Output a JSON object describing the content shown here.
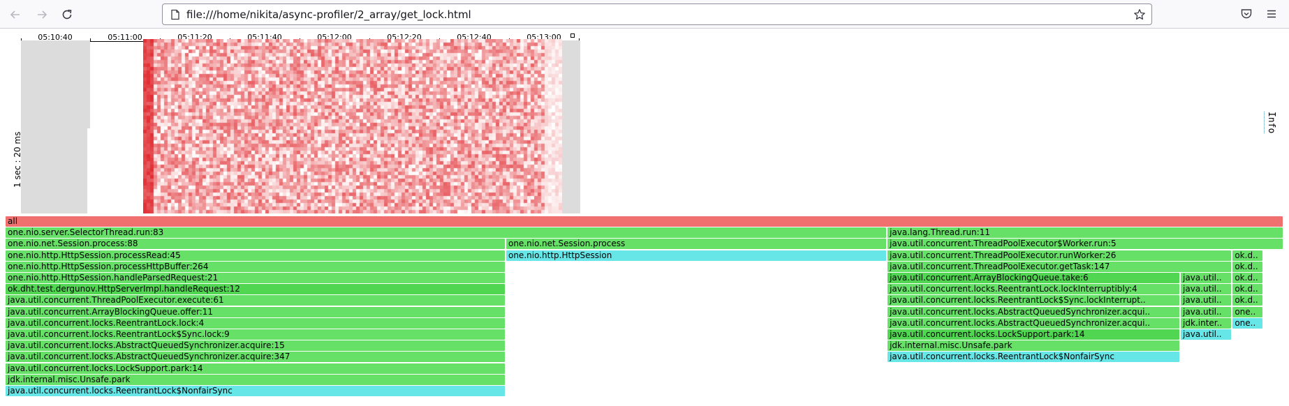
{
  "browser": {
    "url": "file:///home/nikita/async-profiler/2_array/get_lock.html"
  },
  "heatmap": {
    "time_ticks": [
      "05:10:40",
      "05:11:00",
      "05:11:20",
      "05:11:40",
      "05:12:00",
      "05:12:20",
      "05:12:40",
      "05:13:00"
    ],
    "y_label": "1 sec : 20 ms",
    "info_label": "Info",
    "colors": {
      "cold": "#ffffff",
      "hot": "#e0202a",
      "gap": "#dcdcdc"
    }
  },
  "flame": {
    "colors": {
      "root": "#f07070",
      "java": "#66e066",
      "java_dark": "#50d650",
      "inlined": "#66e6e6"
    },
    "frames": [
      {
        "label": "all",
        "row": 0,
        "start": 0.0,
        "width": 1.0,
        "kind": "root"
      },
      {
        "label": "one.nio.server.SelectorThread.run:83",
        "row": 1,
        "start": 0.0,
        "width": 0.6895,
        "kind": "java"
      },
      {
        "label": "one.nio.net.Session.process:88",
        "row": 2,
        "start": 0.0,
        "width": 0.3912,
        "kind": "java"
      },
      {
        "label": "one.nio.http.HttpSession.processRead:45",
        "row": 3,
        "start": 0.0,
        "width": 0.3912,
        "kind": "java"
      },
      {
        "label": "one.nio.http.HttpSession.processHttpBuffer:264",
        "row": 4,
        "start": 0.0,
        "width": 0.3912,
        "kind": "java"
      },
      {
        "label": "one.nio.http.HttpSession.handleParsedRequest:21",
        "row": 5,
        "start": 0.0,
        "width": 0.3912,
        "kind": "java"
      },
      {
        "label": "ok.dht.test.dergunov.HttpServerImpl.handleRequest:12",
        "row": 6,
        "start": 0.0,
        "width": 0.3912,
        "kind": "java_dark"
      },
      {
        "label": "java.util.concurrent.ThreadPoolExecutor.execute:61",
        "row": 7,
        "start": 0.0,
        "width": 0.3912,
        "kind": "java"
      },
      {
        "label": "java.util.concurrent.ArrayBlockingQueue.offer:11",
        "row": 8,
        "start": 0.0,
        "width": 0.3912,
        "kind": "java"
      },
      {
        "label": "java.util.concurrent.locks.ReentrantLock.lock:4",
        "row": 9,
        "start": 0.0,
        "width": 0.3912,
        "kind": "java"
      },
      {
        "label": "java.util.concurrent.locks.ReentrantLock$Sync.lock:9",
        "row": 10,
        "start": 0.0,
        "width": 0.3912,
        "kind": "java"
      },
      {
        "label": "java.util.concurrent.locks.AbstractQueuedSynchronizer.acquire:15",
        "row": 11,
        "start": 0.0,
        "width": 0.3912,
        "kind": "java"
      },
      {
        "label": "java.util.concurrent.locks.AbstractQueuedSynchronizer.acquire:347",
        "row": 12,
        "start": 0.0,
        "width": 0.3912,
        "kind": "java"
      },
      {
        "label": "java.util.concurrent.locks.LockSupport.park:14",
        "row": 13,
        "start": 0.0,
        "width": 0.3912,
        "kind": "java"
      },
      {
        "label": "jdk.internal.misc.Unsafe.park",
        "row": 14,
        "start": 0.0,
        "width": 0.3912,
        "kind": "java"
      },
      {
        "label": "java.util.concurrent.locks.ReentrantLock$NonfairSync",
        "row": 15,
        "start": 0.0,
        "width": 0.3912,
        "kind": "inlined"
      },
      {
        "label": "one.nio.net.Session.process",
        "row": 2,
        "start": 0.3918,
        "width": 0.2977,
        "kind": "java"
      },
      {
        "label": "one.nio.http.HttpSession",
        "row": 3,
        "start": 0.3918,
        "width": 0.2977,
        "kind": "inlined"
      },
      {
        "label": "java.lang.Thread.run:11",
        "row": 1,
        "start": 0.6902,
        "width": 0.3098,
        "kind": "java"
      },
      {
        "label": "java.util.concurrent.ThreadPoolExecutor$Worker.run:5",
        "row": 2,
        "start": 0.6902,
        "width": 0.3098,
        "kind": "java"
      },
      {
        "label": "java.util.concurrent.ThreadPoolExecutor.runWorker:26",
        "row": 3,
        "start": 0.6902,
        "width": 0.2694,
        "kind": "java"
      },
      {
        "label": "java.util.concurrent.ThreadPoolExecutor.getTask:147",
        "row": 4,
        "start": 0.6902,
        "width": 0.2694,
        "kind": "java"
      },
      {
        "label": "java.util.concurrent.ArrayBlockingQueue.take:6",
        "row": 5,
        "start": 0.6902,
        "width": 0.2289,
        "kind": "java_dark"
      },
      {
        "label": "java.util.concurrent.locks.ReentrantLock.lockInterruptibly:4",
        "row": 6,
        "start": 0.6902,
        "width": 0.2289,
        "kind": "java"
      },
      {
        "label": "java.util.concurrent.locks.ReentrantLock$Sync.lockInterrupt..",
        "row": 7,
        "start": 0.6902,
        "width": 0.2289,
        "kind": "java"
      },
      {
        "label": "java.util.concurrent.locks.AbstractQueuedSynchronizer.acqui..",
        "row": 8,
        "start": 0.6902,
        "width": 0.2289,
        "kind": "java"
      },
      {
        "label": "java.util.concurrent.locks.AbstractQueuedSynchronizer.acqui..",
        "row": 9,
        "start": 0.6902,
        "width": 0.2289,
        "kind": "java"
      },
      {
        "label": "java.util.concurrent.locks.LockSupport.park:14",
        "row": 10,
        "start": 0.6902,
        "width": 0.2289,
        "kind": "java_dark"
      },
      {
        "label": "jdk.internal.misc.Unsafe.park",
        "row": 11,
        "start": 0.6902,
        "width": 0.2289,
        "kind": "java"
      },
      {
        "label": "java.util.concurrent.locks.ReentrantLock$NonfairSync",
        "row": 12,
        "start": 0.6902,
        "width": 0.2289,
        "kind": "inlined"
      },
      {
        "label": "java.util..",
        "row": 5,
        "start": 0.9197,
        "width": 0.04,
        "kind": "java"
      },
      {
        "label": "java.util..",
        "row": 6,
        "start": 0.9197,
        "width": 0.04,
        "kind": "java"
      },
      {
        "label": "java.util..",
        "row": 7,
        "start": 0.9197,
        "width": 0.04,
        "kind": "java"
      },
      {
        "label": "java.util..",
        "row": 8,
        "start": 0.9197,
        "width": 0.04,
        "kind": "java"
      },
      {
        "label": "jdk.inter..",
        "row": 9,
        "start": 0.9197,
        "width": 0.04,
        "kind": "java"
      },
      {
        "label": "java.util..",
        "row": 10,
        "start": 0.9197,
        "width": 0.04,
        "kind": "inlined"
      },
      {
        "label": "ok.d..",
        "row": 3,
        "start": 0.9603,
        "width": 0.024,
        "kind": "java"
      },
      {
        "label": "ok.d..",
        "row": 4,
        "start": 0.9603,
        "width": 0.024,
        "kind": "java"
      },
      {
        "label": "ok.d..",
        "row": 5,
        "start": 0.9603,
        "width": 0.024,
        "kind": "java"
      },
      {
        "label": "ok.d..",
        "row": 6,
        "start": 0.9603,
        "width": 0.024,
        "kind": "java"
      },
      {
        "label": "ok.d..",
        "row": 7,
        "start": 0.9603,
        "width": 0.024,
        "kind": "java"
      },
      {
        "label": "one..",
        "row": 8,
        "start": 0.9603,
        "width": 0.024,
        "kind": "java"
      },
      {
        "label": "one..",
        "row": 9,
        "start": 0.9603,
        "width": 0.024,
        "kind": "inlined"
      }
    ]
  }
}
